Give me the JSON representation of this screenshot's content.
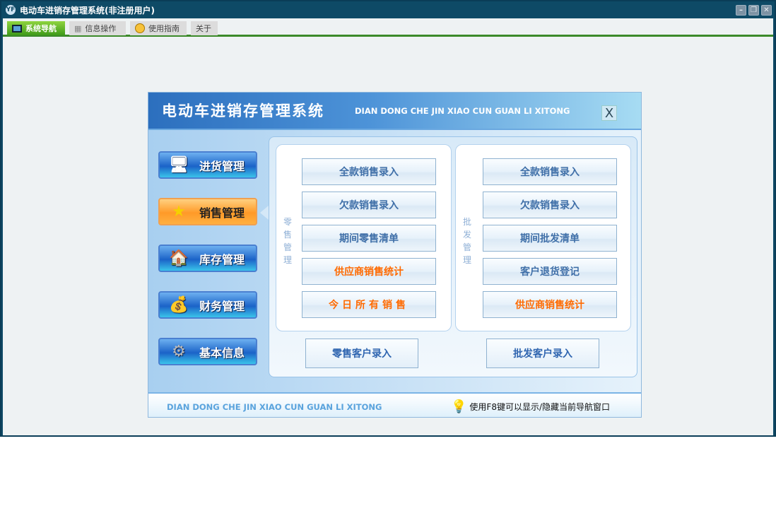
{
  "window": {
    "title": "电动车进销存管理系统(非注册用户)",
    "logo": "YF",
    "controls": [
      "minimize-icon",
      "restore-icon",
      "close-icon"
    ]
  },
  "tabs": [
    {
      "label": "系统导航",
      "icon": "monitor-icon",
      "active": true
    },
    {
      "label": "信息操作",
      "icon": "grid-icon"
    },
    {
      "label": "使用指南",
      "icon": "help-icon"
    },
    {
      "label": "关于"
    }
  ],
  "dialog": {
    "title": "电动车进销存管理系统",
    "subtitle": "DIAN DONG CHE JIN XIAO CUN GUAN LI XITONG",
    "close": "X",
    "nav": [
      {
        "label": "进货管理",
        "icon": "monitor-icon"
      },
      {
        "label": "销售管理",
        "icon": "star-icon",
        "active": true
      },
      {
        "label": "库存管理",
        "icon": "house-icon"
      },
      {
        "label": "财务管理",
        "icon": "coins-icon"
      },
      {
        "label": "基本信息",
        "icon": "gear-icon"
      }
    ],
    "retail": {
      "label": "零售管理",
      "buttons": [
        {
          "label": "全款销售录入"
        },
        {
          "label": "欠款销售录入"
        },
        {
          "label": "期间零售清单"
        },
        {
          "label": "供应商销售统计",
          "highlight": true
        },
        {
          "label": "今日所有销售",
          "highlight": true
        }
      ],
      "bottom": "零售客户录入"
    },
    "wholesale": {
      "label": "批发管理",
      "buttons": [
        {
          "label": "全款销售录入"
        },
        {
          "label": "欠款销售录入"
        },
        {
          "label": "期间批发清单"
        },
        {
          "label": "客户退货登记"
        },
        {
          "label": "供应商销售统计",
          "highlight": true
        }
      ],
      "bottom": "批发客户录入"
    },
    "footer": {
      "subtitle": "DIAN DONG CHE JIN XIAO CUN GUAN LI XITONG",
      "tip": "使用F8键可以显示/隐藏当前导航窗口"
    }
  },
  "colors": {
    "titlebar": "#0e4a66",
    "active_tab": "#3e9a19",
    "highlight": "#ff6a00",
    "button_text": "#3f6fa8"
  }
}
